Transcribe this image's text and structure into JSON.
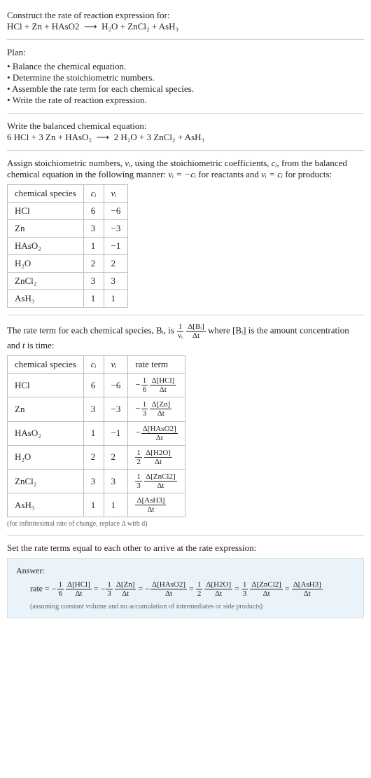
{
  "intro": {
    "prompt": "Construct the rate of reaction expression for:",
    "equation_lhs": "HCl + Zn + HAsO2",
    "arrow": "⟶",
    "equation_rhs": "H₂O + ZnCl₂ + AsH₃"
  },
  "plan": {
    "title": "Plan:",
    "items": [
      "Balance the chemical equation.",
      "Determine the stoichiometric numbers.",
      "Assemble the rate term for each chemical species.",
      "Write the rate of reaction expression."
    ]
  },
  "balanced": {
    "title": "Write the balanced chemical equation:",
    "lhs": "6 HCl + 3 Zn + HAsO₂",
    "arrow": "⟶",
    "rhs": "2 H₂O + 3 ZnCl₂ + AsH₃"
  },
  "stoich_text": {
    "p1a": "Assign stoichiometric numbers, ",
    "nu_i": "νᵢ",
    "p1b": ", using the stoichiometric coefficients, ",
    "c_i": "cᵢ",
    "p1c": ", from the balanced chemical equation in the following manner: ",
    "rel_react": "νᵢ = −cᵢ",
    "p1d": " for reactants and ",
    "rel_prod": "νᵢ = cᵢ",
    "p1e": " for products:"
  },
  "stoich_table": {
    "headers": [
      "chemical species",
      "cᵢ",
      "νᵢ"
    ],
    "rows": [
      {
        "sp": "HCl",
        "c": "6",
        "nu": "−6"
      },
      {
        "sp": "Zn",
        "c": "3",
        "nu": "−3"
      },
      {
        "sp": "HAsO₂",
        "c": "1",
        "nu": "−1"
      },
      {
        "sp": "H₂O",
        "c": "2",
        "nu": "2"
      },
      {
        "sp": "ZnCl₂",
        "c": "3",
        "nu": "3"
      },
      {
        "sp": "AsH₃",
        "c": "1",
        "nu": "1"
      }
    ]
  },
  "rateterm_text": {
    "a": "The rate term for each chemical species, Bᵢ, is ",
    "b": " where [Bᵢ] is the amount concentration and ",
    "t": "t",
    "c": " is time:"
  },
  "rate_frac1": {
    "num": "1",
    "den": "νᵢ"
  },
  "rate_frac2": {
    "num": "Δ[Bᵢ]",
    "den": "Δt"
  },
  "rate_table": {
    "headers": [
      "chemical species",
      "cᵢ",
      "νᵢ",
      "rate term"
    ],
    "rows": [
      {
        "sp": "HCl",
        "c": "6",
        "nu": "−6",
        "sign": "−",
        "coef_num": "1",
        "coef_den": "6",
        "dnum": "Δ[HCl]",
        "dden": "Δt"
      },
      {
        "sp": "Zn",
        "c": "3",
        "nu": "−3",
        "sign": "−",
        "coef_num": "1",
        "coef_den": "3",
        "dnum": "Δ[Zn]",
        "dden": "Δt"
      },
      {
        "sp": "HAsO₂",
        "c": "1",
        "nu": "−1",
        "sign": "−",
        "coef_num": "",
        "coef_den": "",
        "dnum": "Δ[HAsO2]",
        "dden": "Δt"
      },
      {
        "sp": "H₂O",
        "c": "2",
        "nu": "2",
        "sign": "",
        "coef_num": "1",
        "coef_den": "2",
        "dnum": "Δ[H2O]",
        "dden": "Δt"
      },
      {
        "sp": "ZnCl₂",
        "c": "3",
        "nu": "3",
        "sign": "",
        "coef_num": "1",
        "coef_den": "3",
        "dnum": "Δ[ZnCl2]",
        "dden": "Δt"
      },
      {
        "sp": "AsH₃",
        "c": "1",
        "nu": "1",
        "sign": "",
        "coef_num": "",
        "coef_den": "",
        "dnum": "Δ[AsH3]",
        "dden": "Δt"
      }
    ]
  },
  "footnote": "(for infinitesimal rate of change, replace Δ with d)",
  "final_text": "Set the rate terms equal to each other to arrive at the rate expression:",
  "answer": {
    "label": "Answer:",
    "lead": "rate = ",
    "eq": " = ",
    "terms": [
      {
        "sign": "−",
        "coef_num": "1",
        "coef_den": "6",
        "dnum": "Δ[HCl]",
        "dden": "Δt"
      },
      {
        "sign": "−",
        "coef_num": "1",
        "coef_den": "3",
        "dnum": "Δ[Zn]",
        "dden": "Δt"
      },
      {
        "sign": "−",
        "coef_num": "",
        "coef_den": "",
        "dnum": "Δ[HAsO2]",
        "dden": "Δt"
      },
      {
        "sign": "",
        "coef_num": "1",
        "coef_den": "2",
        "dnum": "Δ[H2O]",
        "dden": "Δt"
      },
      {
        "sign": "",
        "coef_num": "1",
        "coef_den": "3",
        "dnum": "Δ[ZnCl2]",
        "dden": "Δt"
      },
      {
        "sign": "",
        "coef_num": "",
        "coef_den": "",
        "dnum": "Δ[AsH3]",
        "dden": "Δt"
      }
    ],
    "assume": "(assuming constant volume and no accumulation of intermediates or side products)"
  }
}
